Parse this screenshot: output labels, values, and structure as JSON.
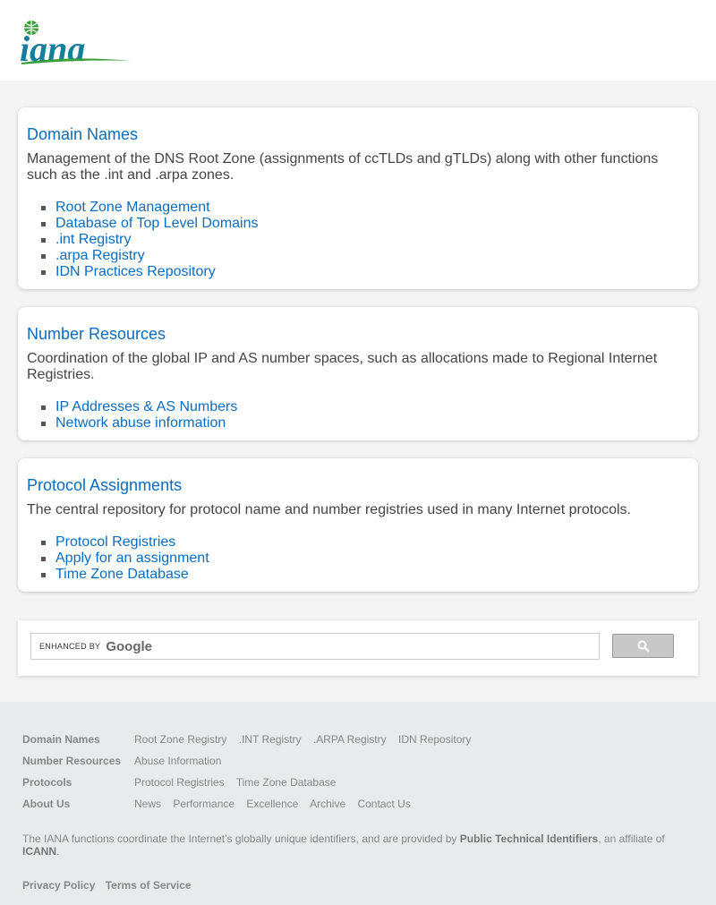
{
  "header": {
    "logo_text": "iana"
  },
  "cards": [
    {
      "title": "Domain Names",
      "desc": "Management of the DNS Root Zone (assignments of ccTLDs and gTLDs) along with other functions such as the .int and .arpa zones.",
      "links": [
        "Root Zone Management",
        "Database of Top Level Domains",
        ".int Registry",
        ".arpa Registry",
        "IDN Practices Repository"
      ]
    },
    {
      "title": "Number Resources",
      "desc": "Coordination of the global IP and AS number spaces, such as allocations made to Regional Internet Registries.",
      "links": [
        "IP Addresses & AS Numbers",
        "Network abuse information"
      ]
    },
    {
      "title": "Protocol Assignments",
      "desc": "The central repository for protocol name and number registries used in many Internet protocols.",
      "links": [
        "Protocol Registries",
        "Apply for an assignment",
        "Time Zone Database"
      ]
    }
  ],
  "search": {
    "enhanced_by": "ENHANCED BY",
    "brand": "Google",
    "button_icon": "search-icon"
  },
  "footer": {
    "rows": [
      {
        "head": "Domain Names",
        "links": [
          "Root Zone Registry",
          ".INT Registry",
          ".ARPA Registry",
          "IDN Repository"
        ]
      },
      {
        "head": "Number Resources",
        "links": [
          "Abuse Information"
        ]
      },
      {
        "head": "Protocols",
        "links": [
          "Protocol Registries",
          "Time Zone Database"
        ]
      },
      {
        "head": "About Us",
        "links": [
          "News",
          "Performance",
          "Excellence",
          "Archive",
          "Contact Us"
        ]
      }
    ],
    "note_pre": "The IANA functions coordinate the Internet’s globally unique identifiers, and are provided by ",
    "note_link1": "Public Technical Identifiers",
    "note_mid": ", an affiliate of ",
    "note_link2": "ICANN",
    "note_post": ".",
    "legal": [
      "Privacy Policy",
      "Terms of Service"
    ]
  }
}
